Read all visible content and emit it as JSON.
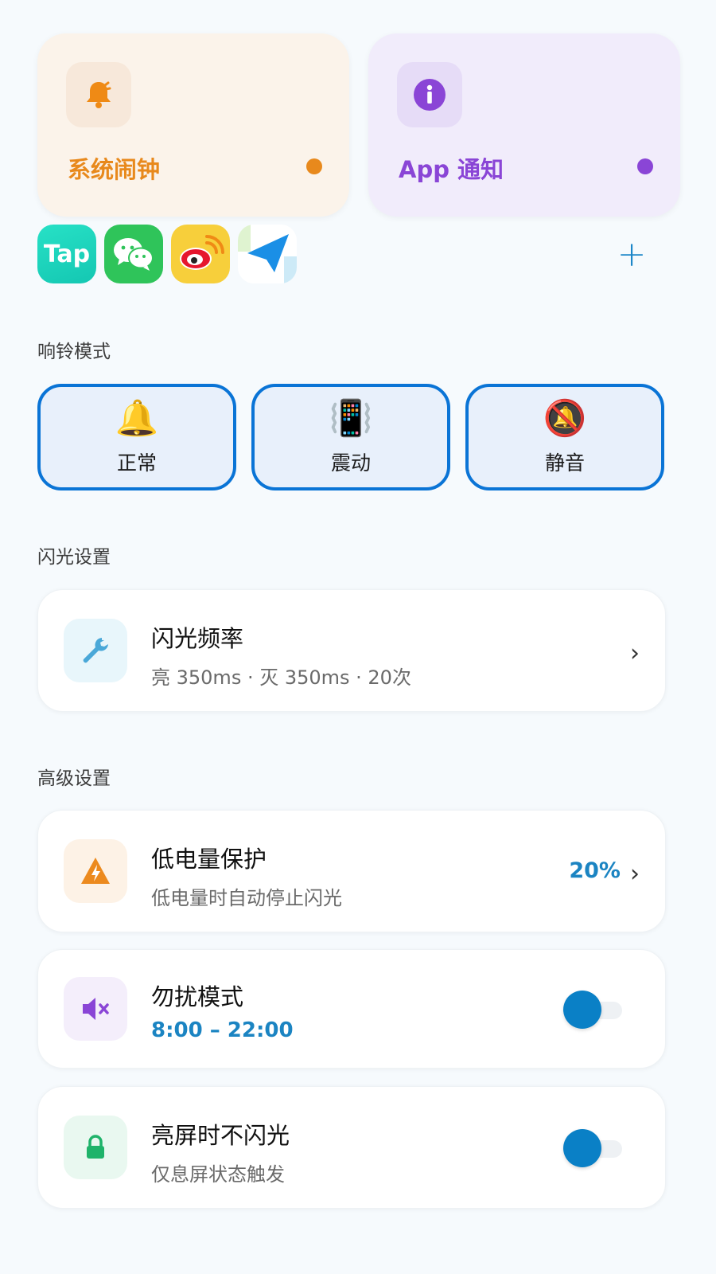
{
  "top_cards": {
    "alarm": {
      "label": "系统闹钟",
      "icon": "bell-icon",
      "color": "#e8891c"
    },
    "notify": {
      "label": "App 通知",
      "icon": "info-icon",
      "color": "#8a45d6"
    }
  },
  "apps": [
    {
      "name": "Tap",
      "icon": "taptap-app-icon"
    },
    {
      "name": "wechat",
      "icon": "wechat-app-icon"
    },
    {
      "name": "weibo",
      "icon": "weibo-app-icon"
    },
    {
      "name": "send",
      "icon": "paper-plane-app-icon"
    }
  ],
  "add_label": "+",
  "ring_section": {
    "title": "响铃模式",
    "modes": [
      {
        "label": "正常",
        "emoji": "🔔"
      },
      {
        "label": "震动",
        "emoji": "📳"
      },
      {
        "label": "静音",
        "emoji": "🔕"
      }
    ]
  },
  "flash_section": {
    "title": "闪光设置",
    "frequency": {
      "title": "闪光频率",
      "sub": "亮 350ms · 灭 350ms · 20次",
      "chevron": "›"
    }
  },
  "advanced_section": {
    "title": "高级设置",
    "battery": {
      "title": "低电量保护",
      "sub": "低电量时自动停止闪光",
      "value": "20%",
      "chevron": "›"
    },
    "dnd": {
      "title": "勿扰模式",
      "sub": "8:00 – 22:00",
      "enabled": true
    },
    "screen": {
      "title": "亮屏时不闪光",
      "sub": "仅息屏状态触发",
      "enabled": true
    }
  },
  "colors": {
    "accent": "#0a74d6",
    "value_blue": "#1b84c2",
    "toggle_on": "#0a80c6"
  }
}
